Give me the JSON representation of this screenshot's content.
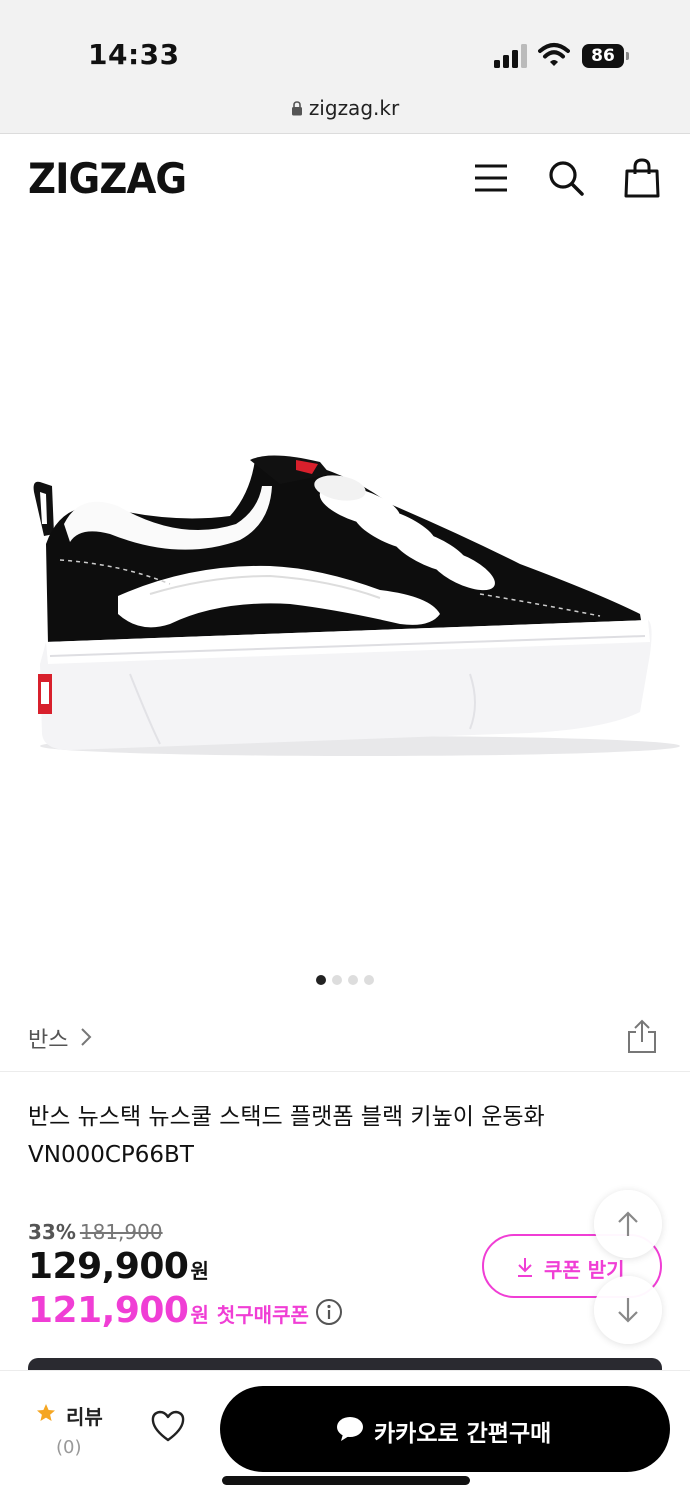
{
  "status_bar": {
    "time": "14:33",
    "battery": "86"
  },
  "browser": {
    "url": "zigzag.kr"
  },
  "header": {
    "logo": "ZIGZAG"
  },
  "carousel": {
    "page_count": 4,
    "active_index": 0
  },
  "brand": {
    "name": "반스"
  },
  "product": {
    "title": "반스 뉴스택 뉴스쿨 스택드 플랫폼 블랙 키높이 운동화 VN000CP66BT",
    "discount_rate": "33%",
    "original_price": "181,900",
    "sale_price": "129,900",
    "sale_currency": "원",
    "coupon_price": "121,900",
    "coupon_currency": "원",
    "coupon_label": "첫구매쿠폰"
  },
  "coupon_button": {
    "label": "쿠폰 받기"
  },
  "bottom_bar": {
    "review_label": "리뷰",
    "review_count": "(0)",
    "buy_label": "카카오로 간편구매"
  },
  "colors": {
    "accent": "#f03ed5",
    "star": "#f5a623",
    "dark": "#000000"
  }
}
